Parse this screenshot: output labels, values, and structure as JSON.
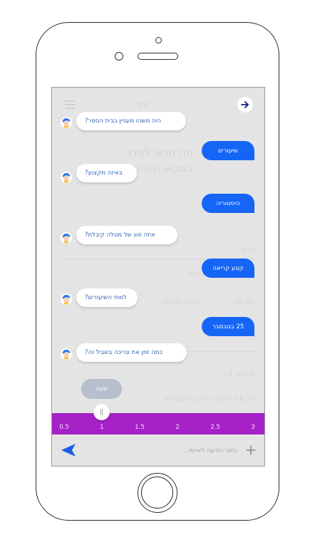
{
  "chat": {
    "messages": [
      {
        "from": "bot",
        "text": "היה משהו מעניין בבית הספר?"
      },
      {
        "from": "user",
        "text": "שיעורים"
      },
      {
        "from": "bot",
        "text": "באיזה מקצוע?"
      },
      {
        "from": "user",
        "text": "היסטוריה"
      },
      {
        "from": "bot",
        "text": "איזה סוג של מטלה קיבלת?"
      },
      {
        "from": "user",
        "text": "קטע קריאה"
      },
      {
        "from": "bot",
        "text": "למתי השיעורים?"
      },
      {
        "from": "user",
        "text": "25 בנובמבר"
      },
      {
        "from": "bot",
        "text": "כמה זמן את צריכה בשביל זה?"
      }
    ],
    "draft_answer": "שעה"
  },
  "slider": {
    "ticks": [
      "0.5",
      "1",
      "1.5",
      "2",
      "2.5",
      "3"
    ],
    "selected_value": 1
  },
  "composer": {
    "placeholder": "כתבי הודעה לאיימי..."
  },
  "background": {
    "header": "יומן",
    "line1": "מה תרצי לסדר",
    "line2": "בשבוע הקרוב?",
    "r1": "היום",
    "r2": "שיעורי בית בהיסטוריה",
    "r3": "18:30",
    "r4": "לימוד למבחן",
    "r5": "שלישי 24",
    "r6": "14:30 שיעורי בית במתמטיקה"
  },
  "colors": {
    "accent_blue": "#1565f7",
    "slider_purple": "#a621c8",
    "bot_text": "#2d5fae"
  }
}
